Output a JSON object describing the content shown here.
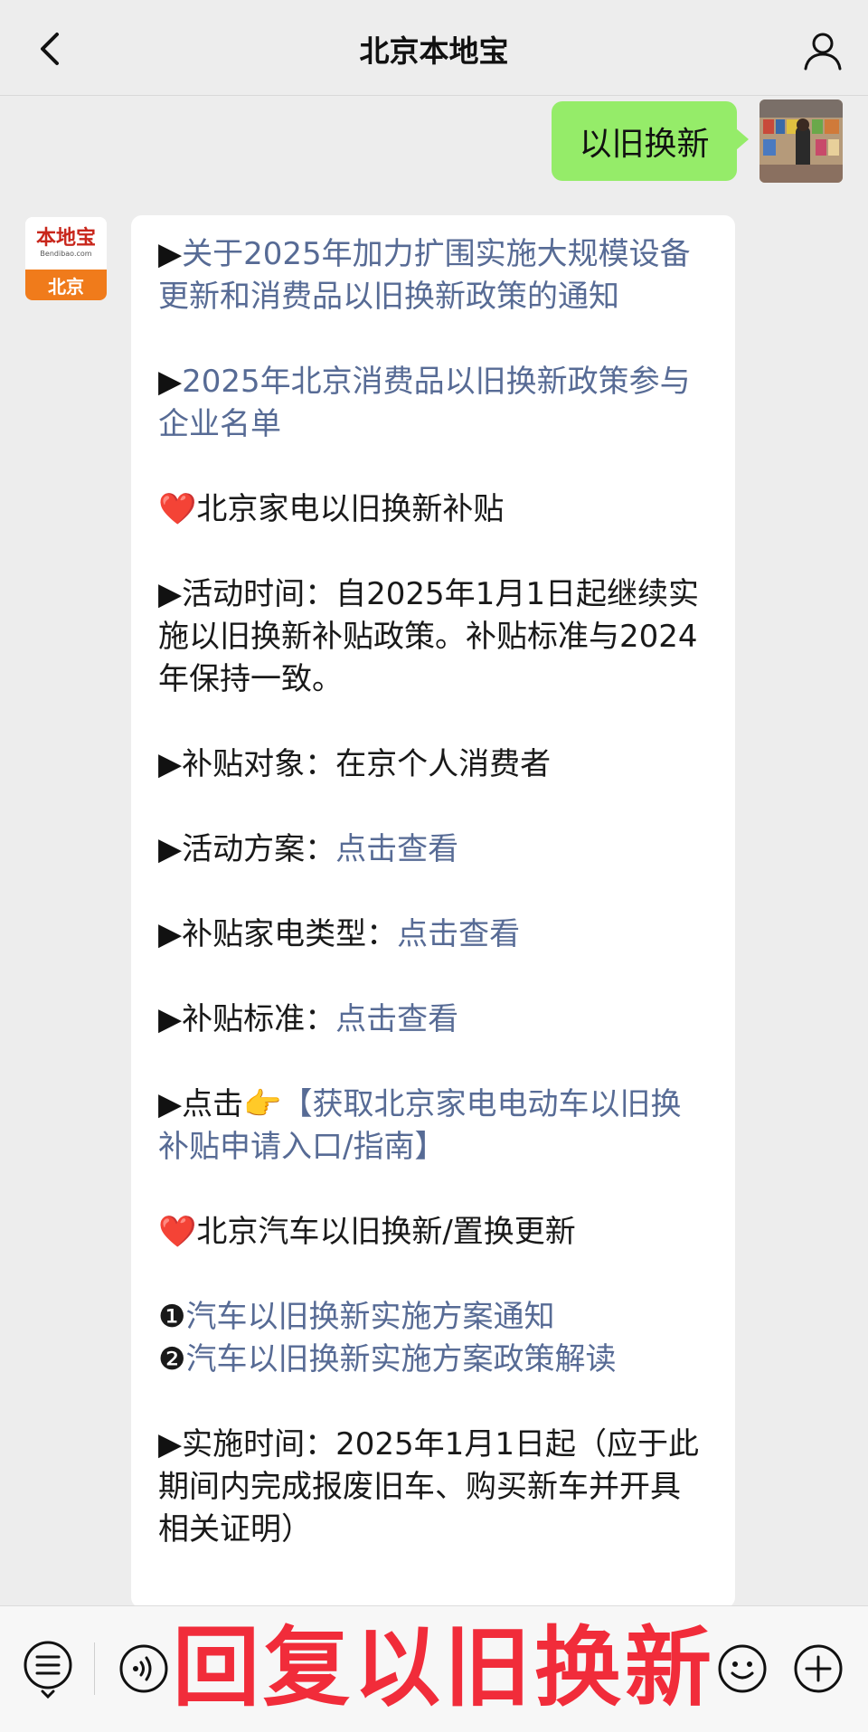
{
  "header": {
    "title": "北京本地宝",
    "back_icon": "chevron-left-icon",
    "user_icon": "user-icon"
  },
  "chat": {
    "outgoing": {
      "text": "以旧换新"
    },
    "incoming": {
      "avatar": {
        "logo": "本地宝",
        "logo_sub": "Bendibao.com",
        "city": "北京"
      },
      "paragraphs": [
        {
          "prefix": "▶",
          "link": "关于2025年加力扩围实施大规模设备更新和消费品以旧换新政策的通知"
        },
        {
          "prefix": "▶",
          "link": "2025年北京消费品以旧换新政策参与企业名单"
        },
        {
          "heart": "❤️",
          "text": "北京家电以旧换新补贴"
        },
        {
          "prefix": "▶",
          "text": "活动时间：自2025年1月1日起继续实施以旧换新补贴政策。补贴标准与2024年保持一致。"
        },
        {
          "prefix": "▶",
          "text": "补贴对象：在京个人消费者"
        },
        {
          "prefix": "▶",
          "text": "活动方案：",
          "link": "点击查看"
        },
        {
          "prefix": "▶",
          "text": "补贴家电类型：",
          "link": "点击查看"
        },
        {
          "prefix": "▶",
          "text": "补贴标准：",
          "link": "点击查看"
        },
        {
          "prefix": "▶",
          "text": "点击👉",
          "link": "【获取北京家电电动车以旧换补贴申请入口/指南】"
        },
        {
          "heart": "❤️",
          "text": "北京汽车以旧换新/置换更新"
        },
        {
          "n1": "❶",
          "link1": "汽车以旧换新实施方案通知",
          "n2": "❷",
          "link2": "汽车以旧换新实施方案政策解读"
        },
        {
          "prefix": "▶",
          "text": "实施时间：2025年1月1日起（应于此期间内完成报废旧车、购买新车并开具相关证明）"
        }
      ]
    }
  },
  "bottom_bar": {
    "menu_icon": "list-menu-icon",
    "voice_icon": "voice-icon",
    "emoji_icon": "emoji-icon",
    "plus_icon": "plus-icon",
    "overlay_text": "回复以旧换新"
  },
  "colors": {
    "link": "#576b95",
    "bubble_me": "#95ec69",
    "overlay": "#f12c3a"
  }
}
